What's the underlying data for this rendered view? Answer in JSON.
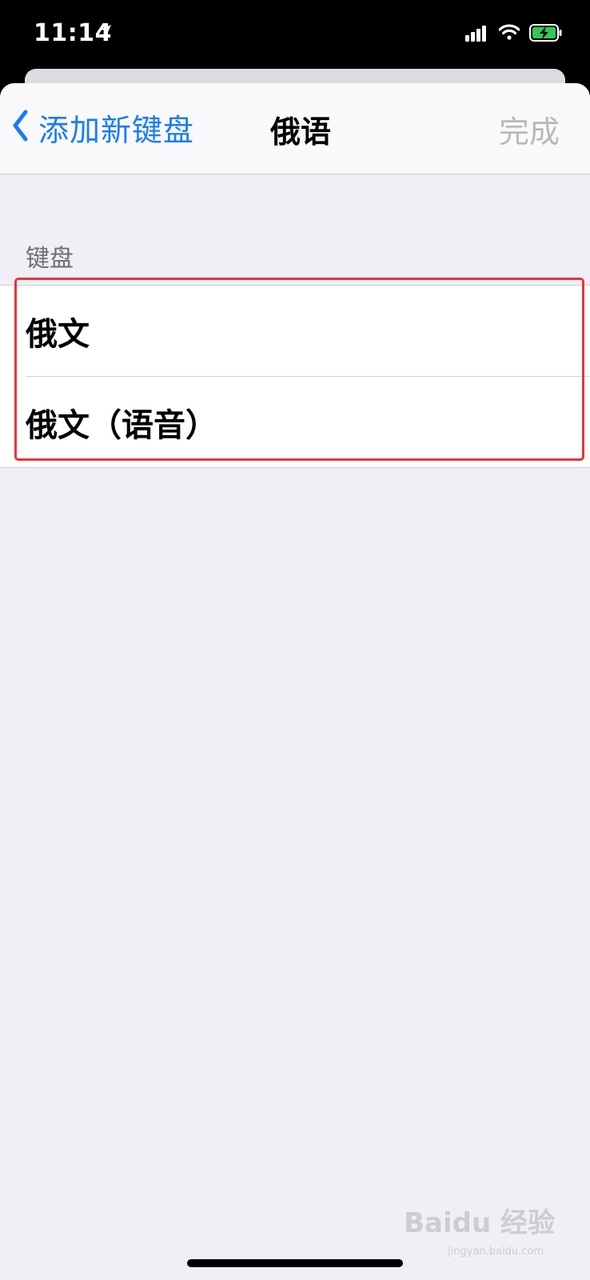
{
  "status_bar": {
    "time": "11:14",
    "icons": [
      "location-arrow-icon",
      "cellular-signal-icon",
      "wifi-icon",
      "battery-charging-icon"
    ]
  },
  "nav": {
    "back_label": "添加新键盘",
    "title": "俄语",
    "done_label": "完成"
  },
  "section": {
    "header": "键盘",
    "items": [
      {
        "label": "俄文"
      },
      {
        "label": "俄文（语音）"
      }
    ]
  },
  "watermark": {
    "brand": "Baidu 经验",
    "url": "jingyan.baidu.com"
  },
  "colors": {
    "accent": "#1a7cf5",
    "disabled": "#b8b8bc",
    "background": "#f1eff5",
    "highlight": "#e8333a",
    "battery": "#34c759"
  }
}
